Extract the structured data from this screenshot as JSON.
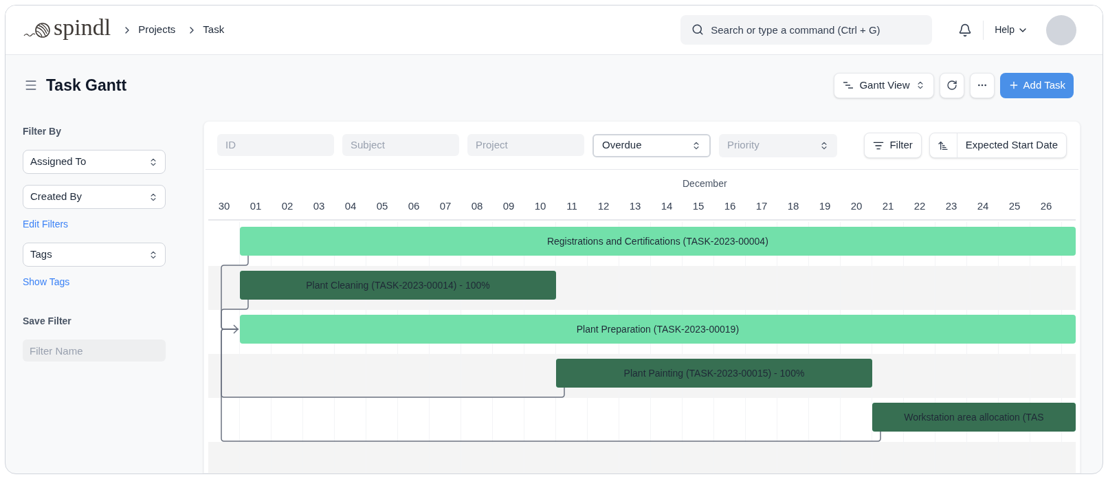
{
  "header": {
    "logo": "spindl",
    "breadcrumbs": [
      "Projects",
      "Task"
    ],
    "search": {
      "placeholder": "Search or type a command (Ctrl + G)"
    },
    "help": "Help"
  },
  "page": {
    "title": "Task Gantt",
    "view_switcher": "Gantt View",
    "add_button": "Add Task"
  },
  "sidebar": {
    "heading": "Filter By",
    "filters": [
      {
        "label": "Assigned To"
      },
      {
        "label": "Created By"
      }
    ],
    "edit_link": "Edit Filters",
    "tags_select": "Tags",
    "tags_link": "Show Tags",
    "save_heading": "Save Filter",
    "filter_name": {
      "placeholder": "Filter Name"
    }
  },
  "toolbar": {
    "fields": [
      {
        "kind": "input",
        "placeholder": "ID"
      },
      {
        "kind": "input",
        "placeholder": "Subject"
      },
      {
        "kind": "input",
        "placeholder": "Project"
      },
      {
        "kind": "select",
        "value": "Overdue"
      },
      {
        "kind": "select",
        "placeholder": "Priority"
      }
    ],
    "filter_button": "Filter",
    "sort": "Expected Start Date"
  },
  "gantt": {
    "month": "December",
    "days": [
      "30",
      "01",
      "02",
      "03",
      "04",
      "05",
      "06",
      "07",
      "08",
      "09",
      "10",
      "11",
      "12",
      "13",
      "14",
      "15",
      "16",
      "17",
      "18",
      "19",
      "20",
      "21",
      "22",
      "23",
      "24",
      "25",
      "26"
    ],
    "tasks": [
      {
        "label": "Registrations and Certifications (TASK-2023-00004)",
        "level": 0
      },
      {
        "label": "Plant Cleaning (TASK-2023-00014) - 100%",
        "level": 1
      },
      {
        "label": "Plant Preparation (TASK-2023-00019)",
        "level": 0
      },
      {
        "label": "Plant Painting (TASK-2023-00015) - 100%",
        "level": 1
      },
      {
        "label": "Workstation area allocation (TAS",
        "level": 1
      }
    ]
  }
}
